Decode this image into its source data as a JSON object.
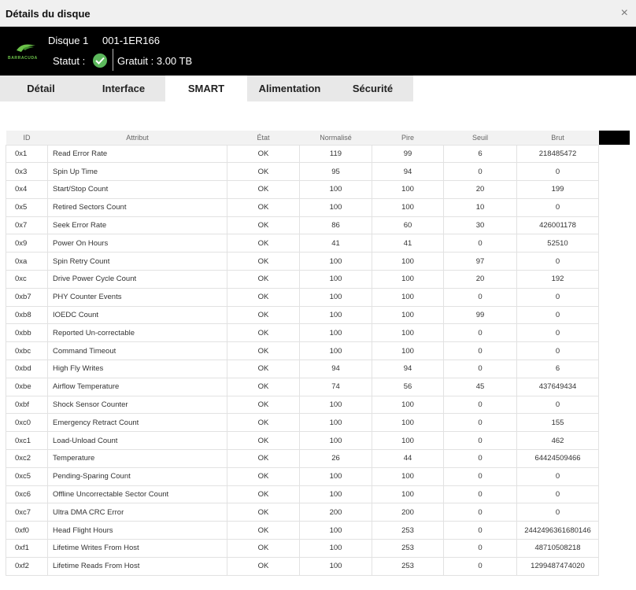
{
  "window": {
    "title": "Détails du disque",
    "close_symbol": "×"
  },
  "header": {
    "brand": "BARRACUDA",
    "disk_name": "Disque 1",
    "disk_serial": "001-1ER166",
    "status_label": "Statut :",
    "status_color": "#5cb85c",
    "free_label": "Gratuit : 3.00 TB"
  },
  "tabs": [
    {
      "label": "Détail"
    },
    {
      "label": "Interface"
    },
    {
      "label": "SMART"
    },
    {
      "label": "Alimentation"
    },
    {
      "label": "Sécurité"
    }
  ],
  "table": {
    "columns": [
      "ID",
      "Attribut",
      "État",
      "Normalisé",
      "Pire",
      "Seuil",
      "Brut"
    ],
    "rows": [
      [
        "0x1",
        "Read Error Rate",
        "OK",
        "119",
        "99",
        "6",
        "218485472"
      ],
      [
        "0x3",
        "Spin Up Time",
        "OK",
        "95",
        "94",
        "0",
        "0"
      ],
      [
        "0x4",
        "Start/Stop Count",
        "OK",
        "100",
        "100",
        "20",
        "199"
      ],
      [
        "0x5",
        "Retired Sectors Count",
        "OK",
        "100",
        "100",
        "10",
        "0"
      ],
      [
        "0x7",
        "Seek Error Rate",
        "OK",
        "86",
        "60",
        "30",
        "426001178"
      ],
      [
        "0x9",
        "Power On Hours",
        "OK",
        "41",
        "41",
        "0",
        "52510"
      ],
      [
        "0xa",
        "Spin Retry Count",
        "OK",
        "100",
        "100",
        "97",
        "0"
      ],
      [
        "0xc",
        "Drive Power Cycle Count",
        "OK",
        "100",
        "100",
        "20",
        "192"
      ],
      [
        "0xb7",
        "PHY Counter Events",
        "OK",
        "100",
        "100",
        "0",
        "0"
      ],
      [
        "0xb8",
        "IOEDC Count",
        "OK",
        "100",
        "100",
        "99",
        "0"
      ],
      [
        "0xbb",
        "Reported Un-correctable",
        "OK",
        "100",
        "100",
        "0",
        "0"
      ],
      [
        "0xbc",
        "Command Timeout",
        "OK",
        "100",
        "100",
        "0",
        "0"
      ],
      [
        "0xbd",
        "High Fly Writes",
        "OK",
        "94",
        "94",
        "0",
        "6"
      ],
      [
        "0xbe",
        "Airflow Temperature",
        "OK",
        "74",
        "56",
        "45",
        "437649434"
      ],
      [
        "0xbf",
        "Shock Sensor Counter",
        "OK",
        "100",
        "100",
        "0",
        "0"
      ],
      [
        "0xc0",
        "Emergency Retract Count",
        "OK",
        "100",
        "100",
        "0",
        "155"
      ],
      [
        "0xc1",
        "Load-Unload Count",
        "OK",
        "100",
        "100",
        "0",
        "462"
      ],
      [
        "0xc2",
        "Temperature",
        "OK",
        "26",
        "44",
        "0",
        "64424509466"
      ],
      [
        "0xc5",
        "Pending-Sparing Count",
        "OK",
        "100",
        "100",
        "0",
        "0"
      ],
      [
        "0xc6",
        "Offline Uncorrectable Sector Count",
        "OK",
        "100",
        "100",
        "0",
        "0"
      ],
      [
        "0xc7",
        "Ultra DMA CRC Error",
        "OK",
        "200",
        "200",
        "0",
        "0"
      ],
      [
        "0xf0",
        "Head Flight Hours",
        "OK",
        "100",
        "253",
        "0",
        "2442496361680146"
      ],
      [
        "0xf1",
        "Lifetime Writes From Host",
        "OK",
        "100",
        "253",
        "0",
        "48710508218"
      ],
      [
        "0xf2",
        "Lifetime Reads From Host",
        "OK",
        "100",
        "253",
        "0",
        "1299487474020"
      ]
    ]
  }
}
